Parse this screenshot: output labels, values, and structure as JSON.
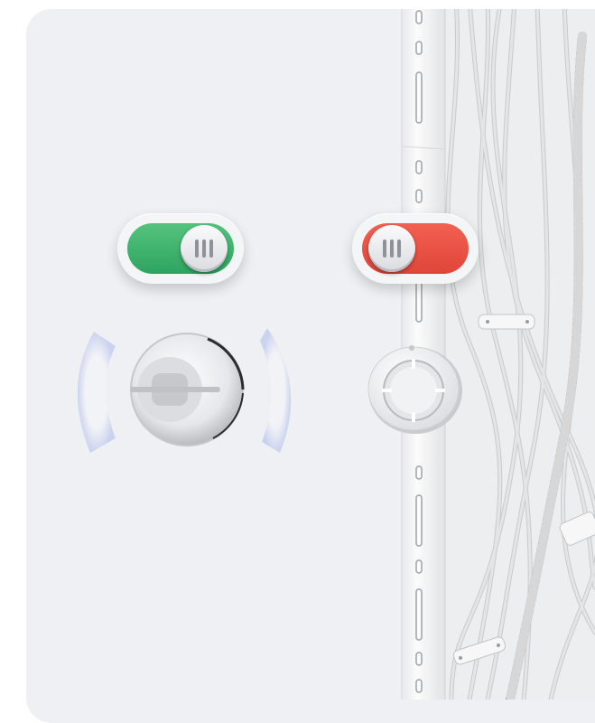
{
  "controls": {
    "toggle_on": {
      "state": "on",
      "color": "#3db56b",
      "icon": "switch-on-icon"
    },
    "toggle_off": {
      "state": "off",
      "color": "#ee5545",
      "icon": "switch-off-icon"
    }
  },
  "devices": {
    "active_sensor": {
      "icon": "sensor-active-icon",
      "signal": "broadcasting",
      "signal_color": "#c9d2ee"
    },
    "mounted_sensor": {
      "icon": "sensor-mounted-icon"
    }
  },
  "colors": {
    "background": "#eef0f3",
    "rail": "#f6f6f6",
    "cable": "#dcdcdc"
  }
}
